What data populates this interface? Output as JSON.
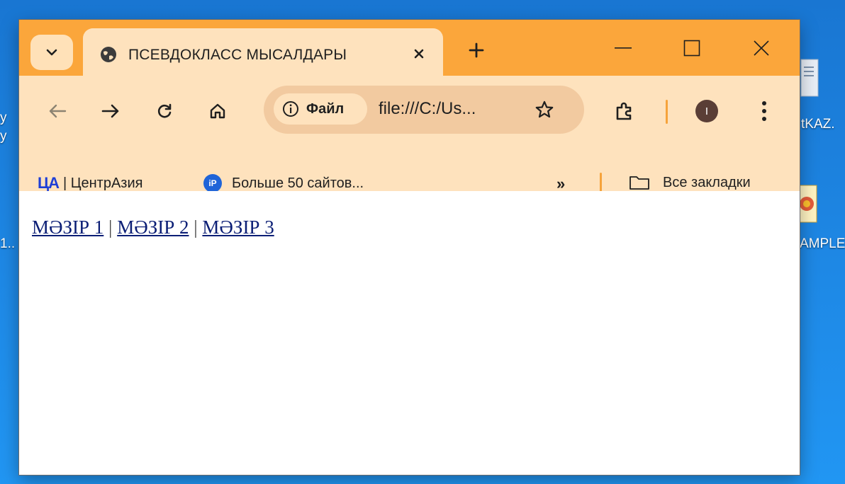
{
  "desktop": {
    "left_labels": [
      "у",
      "у",
      "1.."
    ],
    "right_labels": [
      "tKAZ.",
      "AMPLE"
    ]
  },
  "tab": {
    "search_icon": "chevron-down-icon",
    "title": "ПСЕВДОКЛАСС МЫСАЛДАРЫ",
    "favicon": "globe-icon"
  },
  "window_controls": [
    "minimize",
    "maximize",
    "close"
  ],
  "address": {
    "chip_label": "Файл",
    "url": "file:///C:/Us..."
  },
  "profile": {
    "initial": "I"
  },
  "bookmarks": {
    "items": [
      {
        "logo": "ЦА",
        "label": "| ЦентрАзия"
      },
      {
        "logo": "iP",
        "label": "Больше 50 сайтов..."
      }
    ],
    "overflow": "»",
    "all_bookmarks_label": "Все закладки"
  },
  "page": {
    "links": [
      "МӘЗІР 1",
      "МӘЗІР 2",
      "МӘЗІР 3"
    ],
    "separator": "|"
  },
  "colors": {
    "titlebar": "#fba63b",
    "toolbar": "#fee2bd",
    "omnibox": "#f2caa0",
    "link": "#0b1e75",
    "desktop": "#1e88e5"
  }
}
